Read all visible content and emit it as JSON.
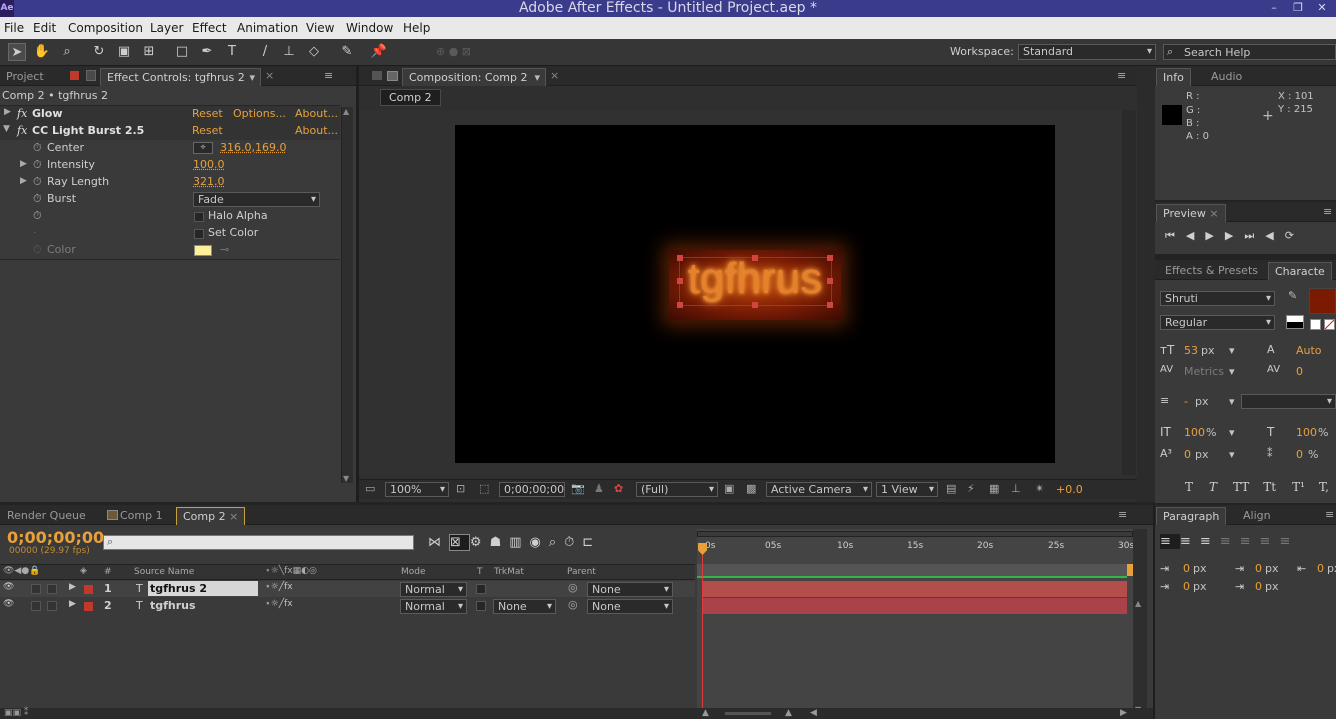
{
  "window": {
    "title": "Adobe After Effects - Untitled Project.aep *",
    "logo": "Ae"
  },
  "menu": [
    "File",
    "Edit",
    "Composition",
    "Layer",
    "Effect",
    "Animation",
    "View",
    "Window",
    "Help"
  ],
  "toolbar": {
    "tools": [
      "selection-tool",
      "hand-tool",
      "zoom-tool",
      "rotation-tool",
      "camera-orbit-tool",
      "pan-behind-tool",
      "rectangle-tool",
      "pen-tool",
      "type-tool",
      "brush-tool",
      "clone-stamp-tool",
      "eraser-tool",
      "roto-brush-tool",
      "puppet-pin-tool"
    ],
    "workspace_label": "Workspace:",
    "workspace_value": "Standard",
    "search_placeholder": "Search Help"
  },
  "left_panel": {
    "tab_project": "Project",
    "tab_effect_controls": "Effect Controls: tgfhrus 2",
    "breadcrumb": "Comp 2 • tgfhrus 2",
    "effects": [
      {
        "name": "Glow",
        "reset": "Reset",
        "options": "Options...",
        "about": "About..."
      },
      {
        "name": "CC Light Burst 2.5",
        "reset": "Reset",
        "about": "About..."
      }
    ],
    "props": {
      "center_label": "Center",
      "center_value": "316.0,169.0",
      "intensity_label": "Intensity",
      "intensity_value": "100.0",
      "ray_length_label": "Ray Length",
      "ray_length_value": "321.0",
      "burst_label": "Burst",
      "burst_value": "Fade",
      "halo_alpha_label": "Halo Alpha",
      "set_color_label": "Set Color",
      "color_label": "Color",
      "color_swatch": "#ffef99"
    }
  },
  "comp_panel": {
    "tab": "Composition: Comp 2",
    "subtab": "Comp 2",
    "layer_text": "tgfhrus",
    "zoom": "100%",
    "timecode": "0;00;00;00",
    "resolution": "(Full)",
    "camera": "Active Camera",
    "views": "1 View",
    "exposure": "+0.0"
  },
  "info_panel": {
    "tab_info": "Info",
    "tab_audio": "Audio",
    "r": "R :",
    "g": "G :",
    "b": "B :",
    "a": "A : 0",
    "x": "X : 101",
    "y": "Y : 215"
  },
  "preview_panel": {
    "tab": "Preview"
  },
  "character_panel": {
    "tab_effects": "Effects & Presets",
    "tab_character": "Characte",
    "font": "Shruti",
    "style": "Regular",
    "fill_color": "#7a1a00",
    "size": "53",
    "size_unit": "px",
    "leading": "Auto",
    "kerning": "Metrics",
    "tracking": "0",
    "stroke_width": "-",
    "stroke_unit": "px",
    "vscale": "100",
    "hscale": "100",
    "scale_unit": "%",
    "baseline": "0",
    "baseline_unit": "px",
    "tsume": "0",
    "tsume_unit": "%",
    "styles": [
      "T",
      "T",
      "TT",
      "Tt",
      "T¹",
      "T,"
    ]
  },
  "paragraph_panel": {
    "tab": "Paragraph",
    "tab_align": "Align",
    "indent1": "0",
    "indent2": "0",
    "indent3": "0",
    "indent4": "0",
    "indent5": "0",
    "unit": "px"
  },
  "timeline": {
    "tab_render": "Render Queue",
    "tab_comp1": "Comp 1",
    "tab_comp2": "Comp 2",
    "timecode": "0;00;00;00",
    "frames": "00000 (29.97 fps)",
    "search_placeholder": "",
    "col_num": "#",
    "col_source": "Source Name",
    "col_mode": "Mode",
    "col_t": "T",
    "col_trkmat": "TrkMat",
    "col_parent": "Parent",
    "ruler": [
      "0s",
      "05s",
      "10s",
      "15s",
      "20s",
      "25s",
      "30s"
    ],
    "layers": [
      {
        "num": "1",
        "name": "tgfhrus 2",
        "mode": "Normal",
        "trkmat": "",
        "parent": "None",
        "label_color": "#c0392b"
      },
      {
        "num": "2",
        "name": "tgfhrus",
        "mode": "Normal",
        "trkmat": "None",
        "parent": "None",
        "label_color": "#c0392b"
      }
    ]
  }
}
